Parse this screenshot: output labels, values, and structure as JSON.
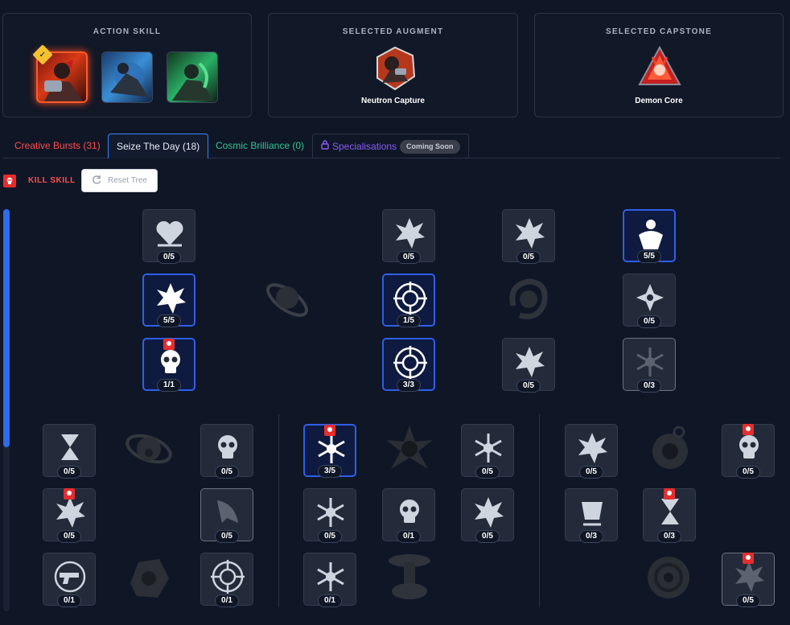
{
  "panels": {
    "action_skill": {
      "title": "ACTION SKILL",
      "selected_icon": "check-icon"
    },
    "augment": {
      "title": "SELECTED AUGMENT",
      "name": "Neutron Capture"
    },
    "capstone": {
      "title": "SELECTED CAPSTONE",
      "name": "Demon Core"
    }
  },
  "tabs": [
    {
      "label": "Creative Bursts (31)",
      "color": "#ff4d4d"
    },
    {
      "label": "Seize The Day (18)",
      "color": "#e6ebf5"
    },
    {
      "label": "Cosmic Brilliance (0)",
      "color": "#34c38f"
    },
    {
      "label": "Specialisations",
      "color": "#8b5cf6",
      "badge": "Coming Soon",
      "icon": "lock-icon"
    }
  ],
  "toolbar": {
    "kill_skill_label": "KILL SKILL",
    "reset_label": "Reset Tree",
    "reset_icon": "refresh-icon"
  },
  "colors": {
    "accent_blue": "#2f5fe8",
    "kill_red": "#e52d2d",
    "background": "#0f1626"
  },
  "nodes": [
    {
      "id": "n1",
      "rank": "0/5"
    },
    {
      "id": "n2",
      "rank": "0/5"
    },
    {
      "id": "n3",
      "rank": "0/5"
    },
    {
      "id": "n4",
      "rank": "5/5"
    },
    {
      "id": "n5",
      "rank": "5/5"
    },
    {
      "id": "n6",
      "rank": "1/5"
    },
    {
      "id": "n7",
      "rank": "0/5"
    },
    {
      "id": "n8",
      "rank": "1/1"
    },
    {
      "id": "n9",
      "rank": "3/3"
    },
    {
      "id": "n10",
      "rank": "0/5"
    },
    {
      "id": "n11",
      "rank": "0/3"
    },
    {
      "id": "l1",
      "rank": "0/5"
    },
    {
      "id": "l2",
      "rank": "0/5"
    },
    {
      "id": "l3",
      "rank": "0/5"
    },
    {
      "id": "l4",
      "rank": "0/5"
    },
    {
      "id": "l5",
      "rank": "0/1"
    },
    {
      "id": "l6",
      "rank": "0/1"
    },
    {
      "id": "m1",
      "rank": "3/5"
    },
    {
      "id": "m2",
      "rank": "0/5"
    },
    {
      "id": "m3",
      "rank": "0/5"
    },
    {
      "id": "m4",
      "rank": "0/1"
    },
    {
      "id": "m5",
      "rank": "0/5"
    },
    {
      "id": "m6",
      "rank": "0/1"
    },
    {
      "id": "r1",
      "rank": "0/5"
    },
    {
      "id": "r2",
      "rank": "0/5"
    },
    {
      "id": "r3",
      "rank": "0/3"
    },
    {
      "id": "r4",
      "rank": "0/3"
    },
    {
      "id": "r5",
      "rank": "0/5"
    }
  ]
}
